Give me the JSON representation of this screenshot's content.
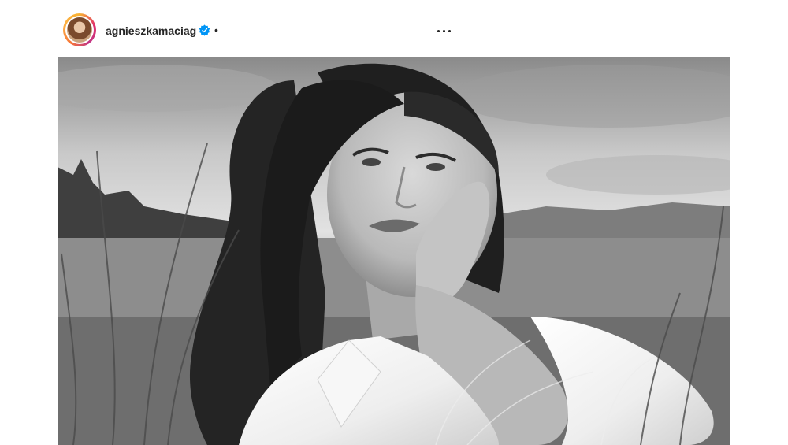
{
  "post": {
    "username": "agnieszkamaciag",
    "verified_icon": "verified-badge-icon",
    "separator": "•",
    "more_icon": "more-options-icon",
    "photo": {
      "style": "black-and-white portrait",
      "subject": "woman with long dark hair in white shirt in grass field"
    }
  },
  "colors": {
    "text": "#262626",
    "verified": "#0095f6",
    "ring_start": "#f9b233",
    "ring_end": "#c13584"
  }
}
